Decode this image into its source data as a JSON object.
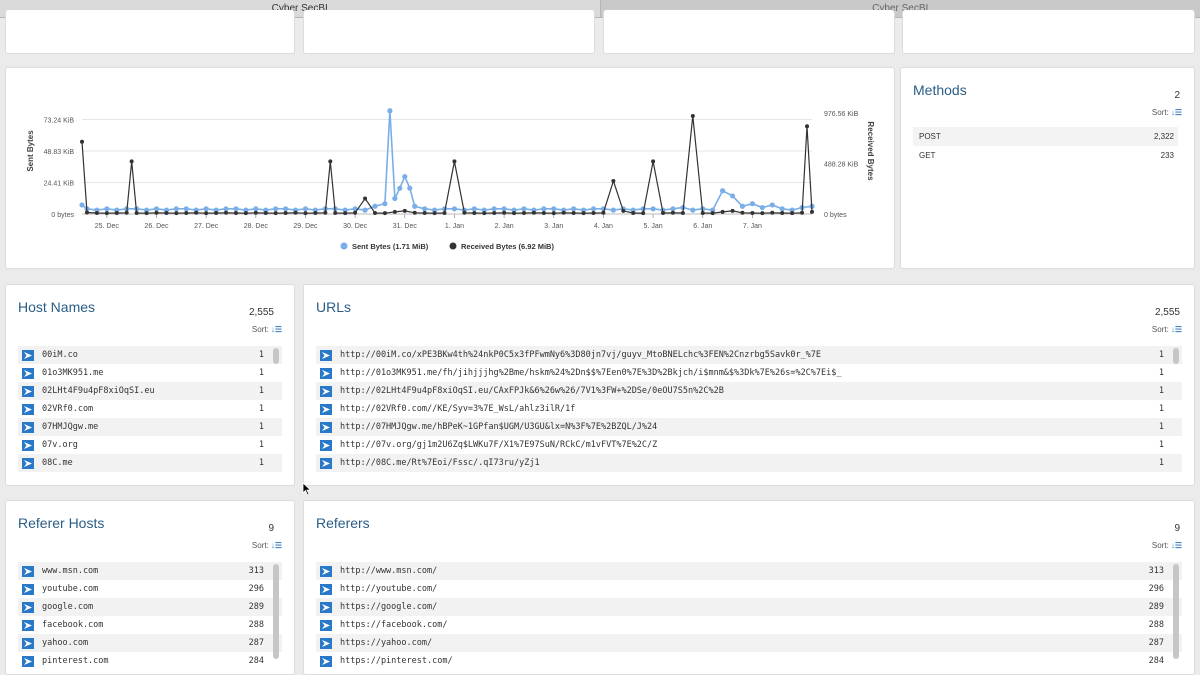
{
  "tabs": [
    {
      "label": "Cyber SecBI",
      "active": true
    },
    {
      "label": "Cyber SecBI",
      "active": false
    }
  ],
  "colors": {
    "accent": "#2a5d87",
    "sent": "#7aaee8",
    "received": "#333333",
    "link_icon": "#2a78c8"
  },
  "methods": {
    "title": "Methods",
    "count": "2",
    "sort_label": "Sort:",
    "items": [
      {
        "label": "POST",
        "value": "2,322"
      },
      {
        "label": "GET",
        "value": "233"
      }
    ]
  },
  "host_names": {
    "title": "Host Names",
    "count": "2,555",
    "sort_label": "Sort:",
    "items": [
      {
        "label": "00iM.co",
        "value": "1"
      },
      {
        "label": "01o3MK951.me",
        "value": "1"
      },
      {
        "label": "02LHt4F9u4pF8xiOqSI.eu",
        "value": "1"
      },
      {
        "label": "02VRf0.com",
        "value": "1"
      },
      {
        "label": "07HMJQgw.me",
        "value": "1"
      },
      {
        "label": "07v.org",
        "value": "1"
      },
      {
        "label": "08C.me",
        "value": "1"
      }
    ]
  },
  "urls": {
    "title": "URLs",
    "count": "2,555",
    "sort_label": "Sort:",
    "items": [
      {
        "label": "http://00iM.co/xPE3BKw4th%24nkP0C5x3fPFwmNy6%3D80jn7vj/guyv_MtoBNELchc%3FEN%2Cnzrbg5Savk0r_%7E",
        "value": "1"
      },
      {
        "label": "http://01o3MK951.me/fh/jihjjjhg%2Bme/hskm%24%2Dn$$%7Een0%7E%3D%2Bkjch/i$mnm&$%3Dk%7E%26s=%2C%7Ei$_",
        "value": "1"
      },
      {
        "label": "http://02LHt4F9u4pF8xiOqSI.eu/CAxFPJk&6%26w%26/7V1%3FW+%2DSe/0eOU7S5n%2C%2B",
        "value": "1"
      },
      {
        "label": "http://02VRf0.com//KE/Syv=3%7E_WsL/ahlz3ilR/1f",
        "value": "1"
      },
      {
        "label": "http://07HMJQgw.me/hBPeK~1GPfan$UGM/U3GU&lx=N%3F%7E%2BZQL/J%24",
        "value": "1"
      },
      {
        "label": "http://07v.org/gj1m2U6Zq$LWKu7F/X1%7E97SuN/RCkC/m1vFVT%7E%2C/Z",
        "value": "1"
      },
      {
        "label": "http://08C.me/Rt%7Eoi/Fssc/.qI73ru/yZj1",
        "value": "1"
      }
    ]
  },
  "referer_hosts": {
    "title": "Referer Hosts",
    "count": "9",
    "sort_label": "Sort:",
    "items": [
      {
        "label": "www.msn.com",
        "value": "313"
      },
      {
        "label": "youtube.com",
        "value": "296"
      },
      {
        "label": "google.com",
        "value": "289"
      },
      {
        "label": "facebook.com",
        "value": "288"
      },
      {
        "label": "yahoo.com",
        "value": "287"
      },
      {
        "label": "pinterest.com",
        "value": "284"
      }
    ]
  },
  "referers": {
    "title": "Referers",
    "count": "9",
    "sort_label": "Sort:",
    "items": [
      {
        "label": "http://www.msn.com/",
        "value": "313"
      },
      {
        "label": "http://youtube.com/",
        "value": "296"
      },
      {
        "label": "https://google.com/",
        "value": "289"
      },
      {
        "label": "https://facebook.com/",
        "value": "288"
      },
      {
        "label": "https://yahoo.com/",
        "value": "287"
      },
      {
        "label": "https://pinterest.com/",
        "value": "284"
      }
    ]
  },
  "chart_data": {
    "type": "line",
    "title": "",
    "xlabel": "",
    "ylabel": "Sent Bytes",
    "y2label": "Received Bytes",
    "x_range": [
      24.5,
      39.2
    ],
    "x_ticks": [
      {
        "x": 25,
        "label": "25. Dec"
      },
      {
        "x": 26,
        "label": "26. Dec"
      },
      {
        "x": 27,
        "label": "27. Dec"
      },
      {
        "x": 28,
        "label": "28. Dec"
      },
      {
        "x": 29,
        "label": "29. Dec"
      },
      {
        "x": 30,
        "label": "30. Dec"
      },
      {
        "x": 31,
        "label": "31. Dec"
      },
      {
        "x": 32,
        "label": "1. Jan"
      },
      {
        "x": 33,
        "label": "2. Jan"
      },
      {
        "x": 34,
        "label": "3. Jan"
      },
      {
        "x": 35,
        "label": "4. Jan"
      },
      {
        "x": 36,
        "label": "5. Jan"
      },
      {
        "x": 37,
        "label": "6. Jan"
      },
      {
        "x": 38,
        "label": "7. Jan"
      }
    ],
    "y_range": [
      0,
      97.65
    ],
    "y_ticks": [
      {
        "v": 0,
        "label": "0 bytes"
      },
      {
        "v": 24.41,
        "label": "24.41 KiB"
      },
      {
        "v": 48.83,
        "label": "48.83 KiB"
      },
      {
        "v": 73.24,
        "label": "73.24 KiB"
      }
    ],
    "y2_range": [
      0,
      1220.7
    ],
    "y2_ticks": [
      {
        "v": 0,
        "label": "0 bytes"
      },
      {
        "v": 488.28,
        "label": "488.28 KiB"
      },
      {
        "v": 976.56,
        "label": "976.56 KiB"
      }
    ],
    "grid": true,
    "legend_position": "bottom",
    "series": [
      {
        "name": "Sent Bytes (1.71 MiB)",
        "color": "#7aaee8",
        "axis": "left",
        "unit": "KiB",
        "x": [
          24.5,
          24.6,
          24.8,
          25.0,
          25.2,
          25.4,
          25.6,
          25.8,
          26.0,
          26.2,
          26.4,
          26.6,
          26.8,
          27.0,
          27.2,
          27.4,
          27.6,
          27.8,
          28.0,
          28.2,
          28.4,
          28.6,
          28.8,
          29.0,
          29.2,
          29.4,
          29.6,
          29.8,
          30.0,
          30.2,
          30.4,
          30.6,
          30.7,
          30.8,
          30.9,
          31.0,
          31.1,
          31.2,
          31.4,
          31.6,
          31.8,
          32.0,
          32.2,
          32.4,
          32.6,
          32.8,
          33.0,
          33.2,
          33.4,
          33.6,
          33.8,
          34.0,
          34.2,
          34.4,
          34.6,
          34.8,
          35.0,
          35.2,
          35.4,
          35.6,
          35.8,
          36.0,
          36.2,
          36.4,
          36.6,
          36.8,
          37.0,
          37.2,
          37.4,
          37.6,
          37.8,
          38.0,
          38.2,
          38.4,
          38.6,
          38.8,
          39.0,
          39.2
        ],
        "y": [
          7,
          4,
          3,
          4,
          3,
          4,
          4,
          3,
          4,
          3,
          4,
          4,
          3,
          4,
          3,
          4,
          4,
          3,
          4,
          3,
          4,
          4,
          3,
          4,
          3,
          4,
          4,
          3,
          4,
          3,
          6,
          8,
          80,
          12,
          20,
          29,
          20,
          6,
          4,
          3,
          4,
          4,
          3,
          4,
          3,
          4,
          4,
          3,
          4,
          3,
          4,
          4,
          3,
          4,
          3,
          4,
          4,
          3,
          4,
          3,
          4,
          4,
          3,
          4,
          5,
          3,
          4,
          3,
          18,
          14,
          6,
          8,
          5,
          7,
          4,
          3,
          5,
          6
        ]
      },
      {
        "name": "Received Bytes (6.92 MiB)",
        "color": "#333333",
        "axis": "right",
        "unit": "KiB",
        "x": [
          24.5,
          24.6,
          24.8,
          25.0,
          25.2,
          25.4,
          25.5,
          25.6,
          25.8,
          26.0,
          26.2,
          26.4,
          26.6,
          26.8,
          27.0,
          27.2,
          27.4,
          27.6,
          27.8,
          28.0,
          28.2,
          28.4,
          28.6,
          28.8,
          29.0,
          29.2,
          29.4,
          29.5,
          29.6,
          29.8,
          30.0,
          30.2,
          30.4,
          30.6,
          30.8,
          31.0,
          31.2,
          31.4,
          31.6,
          31.8,
          32.0,
          32.2,
          32.4,
          32.6,
          32.8,
          33.0,
          33.2,
          33.4,
          33.6,
          33.8,
          34.0,
          34.2,
          34.4,
          34.6,
          34.8,
          35.0,
          35.2,
          35.4,
          35.6,
          35.8,
          36.0,
          36.2,
          36.4,
          36.6,
          36.8,
          37.0,
          37.2,
          37.4,
          37.6,
          37.8,
          38.0,
          38.2,
          38.4,
          38.6,
          38.8,
          39.0,
          39.1,
          39.2
        ],
        "y": [
          700,
          15,
          10,
          8,
          10,
          12,
          510,
          10,
          8,
          12,
          10,
          8,
          10,
          12,
          8,
          10,
          12,
          10,
          8,
          12,
          10,
          8,
          10,
          12,
          8,
          10,
          12,
          510,
          10,
          8,
          12,
          150,
          10,
          8,
          20,
          30,
          12,
          10,
          8,
          10,
          510,
          12,
          10,
          8,
          10,
          12,
          8,
          10,
          12,
          10,
          8,
          12,
          10,
          8,
          10,
          12,
          320,
          30,
          10,
          8,
          510,
          10,
          12,
          10,
          950,
          10,
          8,
          20,
          30,
          12,
          10,
          8,
          12,
          10,
          8,
          12,
          850,
          20
        ]
      }
    ]
  }
}
